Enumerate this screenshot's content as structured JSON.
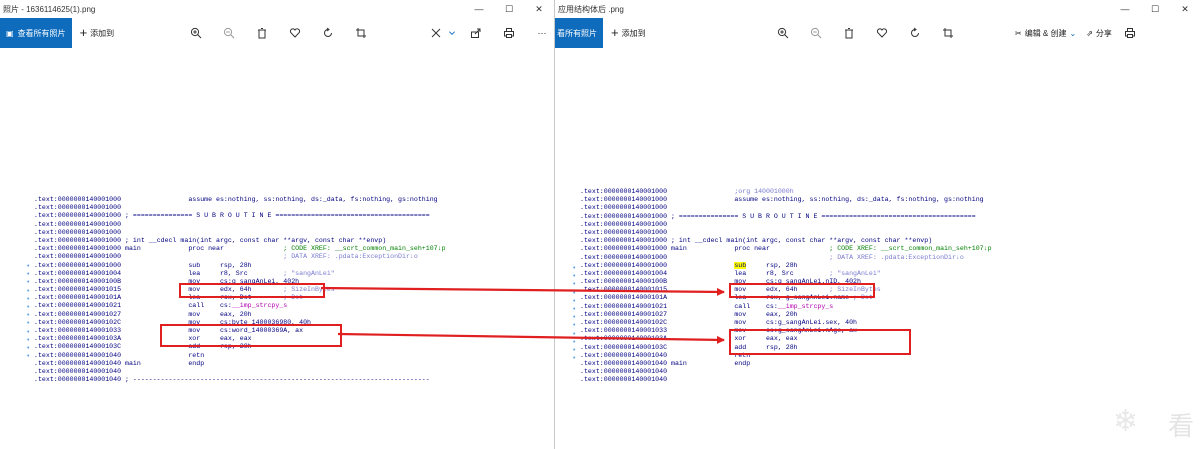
{
  "left": {
    "title": "照片 - 1636114625(1).png",
    "btn_all": "查看所有照片",
    "btn_add": "添加到",
    "code": [
      ".text:0000000140001000                 assume es:nothing, ss:nothing, ds:_data, fs:nothing, gs:nothing",
      ".text:0000000140001000",
      ".text:0000000140001000 ; =============== S U B R O U T I N E =======================================",
      ".text:0000000140001000",
      ".text:0000000140001000",
      ".text:0000000140001000 ; int __cdecl main(int argc, const char **argv, const char **envp)",
      ".text:0000000140001000 main            proc near               ; CODE XREF: __scrt_common_main_seh+107↓p",
      ".text:0000000140001000                                         ; DATA XREF: .pdata:ExceptionDir↓o",
      ".text:0000000140001000                 sub     rsp, 28h",
      ".text:0000000140001004                 lea     r8, Src         ; \"sangAnLei\"",
      ".text:000000014000100B                 mov     cs:g_sangAnLei, 402h",
      ".text:0000000140001015                 mov     edx, 64h        ; SizeInBytes",
      ".text:000000014000101A                 lea     rcx, Dst        ; Dst",
      ".text:0000000140001021                 call    cs:__imp_strcpy_s",
      ".text:0000000140001027                 mov     eax, 20h",
      ".text:000000014000102C                 mov     cs:byte_1400036980, 40h",
      ".text:0000000140001033                 mov     cs:word_14000369A, ax",
      ".text:000000014000103A                 xor     eax, eax",
      ".text:000000014000103C                 add     rsp, 28h",
      ".text:0000000140001040                 retn",
      ".text:0000000140001040 main            endp",
      ".text:0000000140001040",
      ".text:0000000140001040 ; ---------------------------------------------------------------------------"
    ]
  },
  "right": {
    "title": "应用结构体后 .png",
    "btn_all": "看所有照片",
    "btn_add": "添加到",
    "btn_edit": "编辑 & 创建",
    "btn_share": "分享",
    "code": [
      ".text:0000000140001000                 ;org 140001000h",
      ".text:0000000140001000                 assume es:nothing, ss:nothing, ds:_data, fs:nothing, gs:nothing",
      ".text:0000000140001000",
      ".text:0000000140001000 ; =============== S U B R O U T I N E =======================================",
      ".text:0000000140001000",
      ".text:0000000140001000",
      ".text:0000000140001000 ; int __cdecl main(int argc, const char **argv, const char **envp)",
      ".text:0000000140001000 main            proc near               ; CODE XREF: __scrt_common_main_seh+107↓p",
      ".text:0000000140001000                                         ; DATA XREF: .pdata:ExceptionDir↓o",
      ".text:0000000140001000                 sub     rsp, 28h",
      ".text:0000000140001004                 lea     r8, Src         ; \"sangAnLei\"",
      ".text:000000014000100B                 mov     cs:g_sangAnLei.nID, 402h",
      ".text:0000000140001015                 mov     edx, 64h        ; SizeInBytes",
      ".text:000000014000101A                 lea     rcx, g_sangAnLei.name ; Dst",
      ".text:0000000140001021                 call    cs:__imp_strcpy_s",
      ".text:0000000140001027                 mov     eax, 20h",
      ".text:000000014000102C                 mov     cs:g_sangAnLei.sex, 40h",
      ".text:0000000140001033                 mov     cs:g_sangAnLei.nAge, ax",
      ".text:000000014000103A                 xor     eax, eax",
      ".text:000000014000103C                 add     rsp, 28h",
      ".text:0000000140001040                 retn",
      ".text:0000000140001040 main            endp",
      ".text:0000000140001040",
      ".text:0000000140001040"
    ]
  },
  "icons": [
    "zoom-in-icon",
    "zoom-out-icon",
    "delete-icon",
    "heart-icon",
    "rotate-icon",
    "crop-icon",
    "edit-icon",
    "share-icon",
    "print-icon",
    "more-icon"
  ],
  "colors": {
    "accent": "#0f6cbd",
    "highlight_box": "#e02020",
    "code_text": "#000080",
    "comment": "#008000"
  },
  "watermark": "看"
}
